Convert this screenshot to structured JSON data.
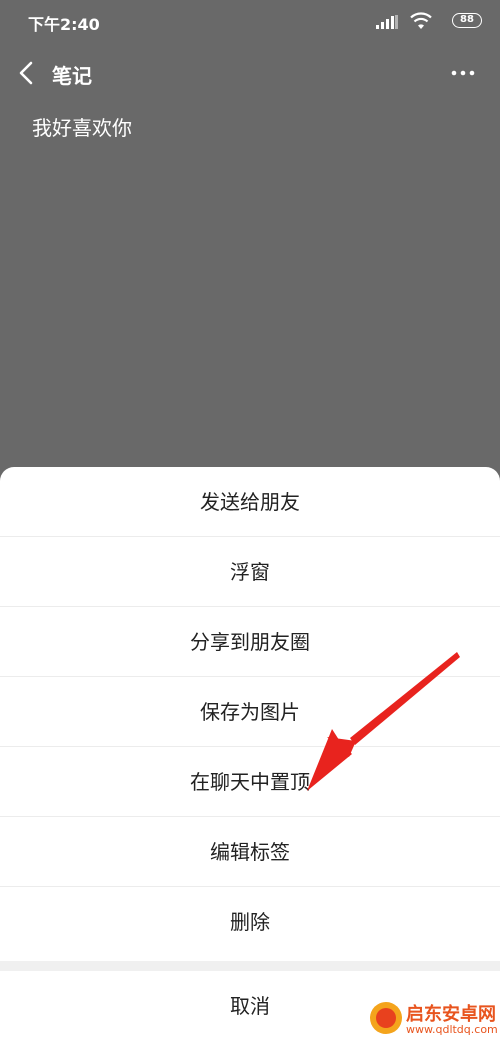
{
  "status_bar": {
    "time": "下午2:40",
    "battery": "88"
  },
  "header": {
    "title": "笔记"
  },
  "note": {
    "content": "我好喜欢你"
  },
  "action_sheet": {
    "items": [
      {
        "label": "发送给朋友"
      },
      {
        "label": "浮窗"
      },
      {
        "label": "分享到朋友圈"
      },
      {
        "label": "保存为图片"
      },
      {
        "label": "在聊天中置顶"
      },
      {
        "label": "编辑标签"
      },
      {
        "label": "删除"
      }
    ],
    "cancel_label": "取消"
  },
  "annotation": {
    "arrow_color": "#e8231e"
  },
  "watermark": {
    "name": "启东安卓网",
    "url": "www.qdltdq.com"
  },
  "colors": {
    "dim_background": "#696969",
    "sheet_background": "#ffffff",
    "text": "#222222"
  }
}
